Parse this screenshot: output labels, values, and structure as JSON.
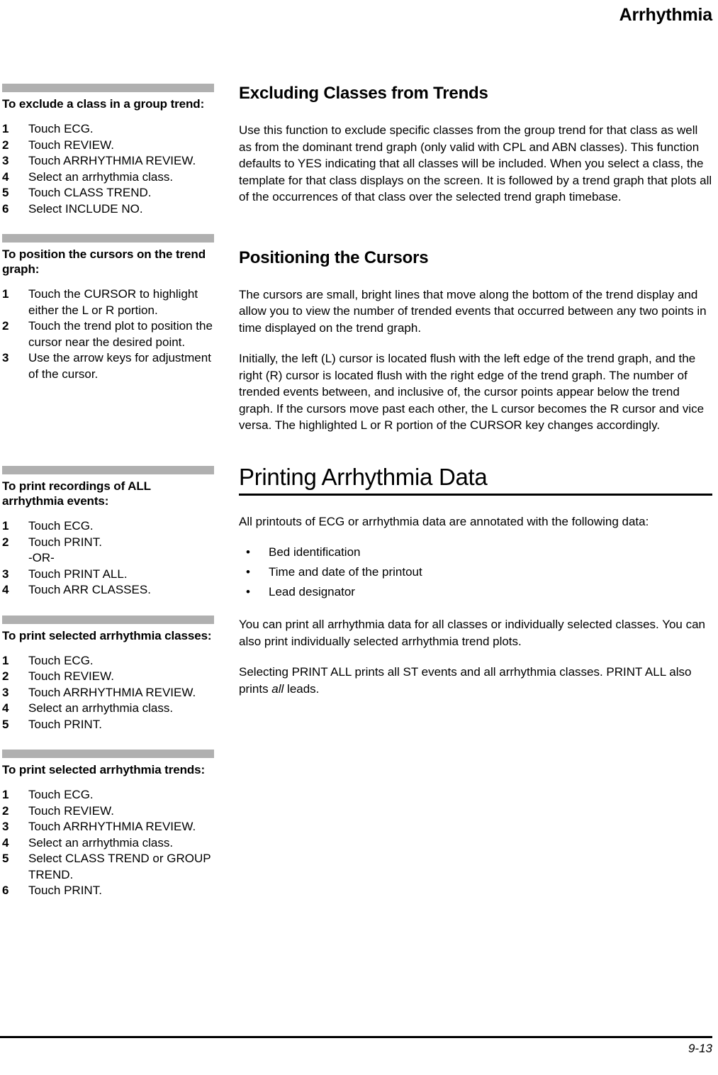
{
  "header": {
    "running_title": "Arrhythmia"
  },
  "footer": {
    "page_number": "9-13"
  },
  "left_column": {
    "blocks": [
      {
        "title": "To exclude a class in a group trend:",
        "steps": [
          {
            "num": "1",
            "text": "Touch ECG."
          },
          {
            "num": "2",
            "text": "Touch REVIEW."
          },
          {
            "num": "3",
            "text": "Touch ARRHYTHMIA REVIEW."
          },
          {
            "num": "4",
            "text": "Select an arrhythmia class."
          },
          {
            "num": "5",
            "text": "Touch CLASS TREND."
          },
          {
            "num": "6",
            "text": "Select INCLUDE NO."
          }
        ]
      },
      {
        "title": "To position the cursors on the trend graph:",
        "steps": [
          {
            "num": "1",
            "text": "Touch the CURSOR to highlight either the L or R portion."
          },
          {
            "num": "2",
            "text": "Touch the trend plot to position the cursor near the desired point."
          },
          {
            "num": "3",
            "text": "Use the arrow keys for adjustment of the cursor."
          }
        ]
      },
      {
        "title": "To print recordings of ALL arrhythmia events:",
        "steps": [
          {
            "num": "1",
            "text": "Touch ECG."
          },
          {
            "num": "2",
            "text": "Touch PRINT."
          },
          {
            "num": "",
            "text": "-OR-"
          },
          {
            "num": "3",
            "text": "Touch PRINT ALL."
          },
          {
            "num": "4",
            "text": "Touch ARR CLASSES."
          }
        ]
      },
      {
        "title": "To print selected arrhythmia classes:",
        "steps": [
          {
            "num": "1",
            "text": "Touch ECG."
          },
          {
            "num": "2",
            "text": "Touch REVIEW."
          },
          {
            "num": "3",
            "text": "Touch ARRHYTHMIA REVIEW."
          },
          {
            "num": "4",
            "text": "Select an arrhythmia class."
          },
          {
            "num": "5",
            "text": "Touch PRINT."
          }
        ]
      },
      {
        "title": "To print selected arrhythmia trends:",
        "steps": [
          {
            "num": "1",
            "text": "Touch ECG."
          },
          {
            "num": "2",
            "text": "Touch REVIEW."
          },
          {
            "num": "3",
            "text": "Touch ARRHYTHMIA REVIEW."
          },
          {
            "num": "4",
            "text": "Select an arrhythmia class."
          },
          {
            "num": "5",
            "text": "Select CLASS TREND or GROUP TREND."
          },
          {
            "num": "6",
            "text": "Touch PRINT."
          }
        ]
      }
    ]
  },
  "right_column": {
    "section_excluding": {
      "heading": "Excluding Classes from Trends",
      "paragraph": "Use this function to exclude specific classes from the group trend for that class as well as from the dominant trend graph (only valid with CPL and ABN classes). This function defaults to YES indicating that all classes will be included. When you select a class, the template for that class displays on the screen. It is followed by a trend graph that plots all of the occurrences of that class over the selected trend graph timebase."
    },
    "section_cursors": {
      "heading": "Positioning the Cursors",
      "paragraph1": "The cursors are small, bright lines that move along the bottom of the trend display and allow you to view the number of trended events that occurred between any two points in time displayed on the trend graph.",
      "paragraph2": "Initially, the left (L) cursor is located flush with the left edge of the trend graph, and the right (R) cursor is located flush with the right edge of the trend graph. The number of trended events between, and inclusive of, the cursor points appear below the trend graph. If the cursors move past each other, the L cursor becomes the R cursor and vice versa. The highlighted L or R portion of the CURSOR key changes accordingly."
    },
    "section_printing": {
      "heading": "Printing Arrhythmia Data",
      "intro": "All printouts of ECG or arrhythmia data are annotated with the following data:",
      "bullet_glyph": "•",
      "bullets": [
        "Bed identification",
        "Time and date of the printout",
        "Lead designator"
      ],
      "paragraph1": "You can print all arrhythmia data for all classes or individually selected classes. You can also print individually selected arrhythmia trend plots.",
      "paragraph2_part1": "Selecting PRINT ALL prints all ST events and all arrhythmia classes. PRINT ALL also prints ",
      "paragraph2_italic": "all",
      "paragraph2_part2": " leads."
    }
  }
}
